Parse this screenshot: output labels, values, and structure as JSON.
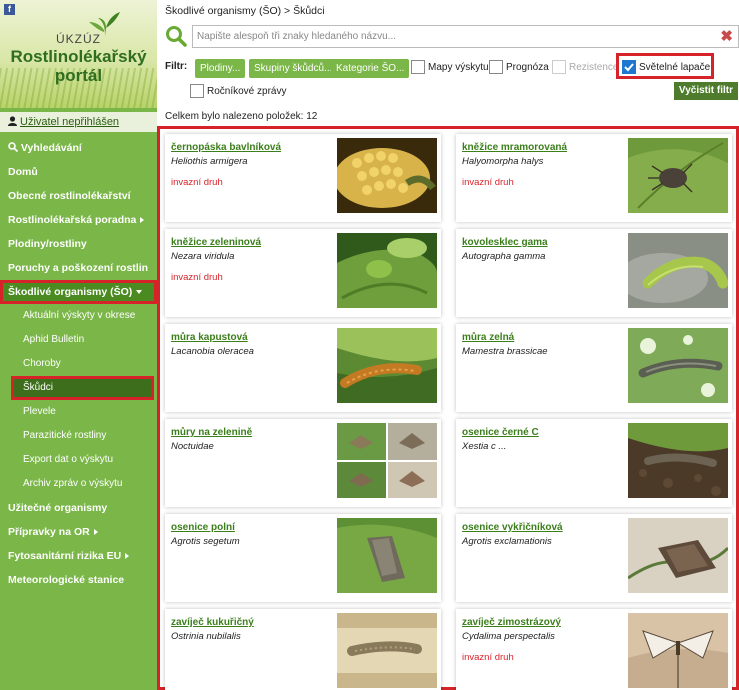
{
  "sidebar": {
    "facebook_icon": "f",
    "logo_small": "ÚKZÚZ",
    "logo_title_1": "Rostlinolékařský",
    "logo_title_2": "portál",
    "user_status": "Uživatel nepřihlášen",
    "nav": [
      {
        "label": "Vyhledávání"
      },
      {
        "label": "Domů"
      },
      {
        "label": "Obecné rostlinolékařství"
      },
      {
        "label": "Rostlinolékařská poradna"
      },
      {
        "label": "Plodiny/rostliny"
      },
      {
        "label": "Poruchy a poškození rostlin"
      },
      {
        "label": "Škodlivé organismy (ŠO)"
      },
      {
        "label": "Aktuální výskyty v okrese"
      },
      {
        "label": "Aphid Bulletin"
      },
      {
        "label": "Choroby"
      },
      {
        "label": "Škůdci"
      },
      {
        "label": "Plevele"
      },
      {
        "label": "Parazitické rostliny"
      },
      {
        "label": "Export dat o výskytu"
      },
      {
        "label": "Archiv zpráv o výskytu"
      },
      {
        "label": "Užitečné organismy"
      },
      {
        "label": "Přípravky na OR"
      },
      {
        "label": "Fytosanitární rizika EU"
      },
      {
        "label": "Meteorologické stanice"
      }
    ]
  },
  "breadcrumb": "Škodlivé organismy (ŠO) > Škůdci",
  "search": {
    "placeholder": "Napište alespoň tři znaky hledaného názvu..."
  },
  "filter": {
    "label": "Filtr:",
    "buttons": [
      "Plodiny...",
      "Skupiny škůdců...",
      "Kategorie ŠO..."
    ],
    "checkboxes": [
      {
        "label": "Mapy výskytu",
        "checked": false
      },
      {
        "label": "Prognóza",
        "checked": false
      },
      {
        "label": "Rezistence",
        "checked": false,
        "disabled": true
      },
      {
        "label": "Světelné lapače",
        "checked": true
      },
      {
        "label": "Ročníkové zprávy",
        "checked": false
      }
    ],
    "clear_label": "Vyčistit filtr"
  },
  "result_count": "Celkem bylo nalezeno položek: 12",
  "cards": [
    {
      "name": "černopáska bavlníková",
      "latin": "Heliothis armigera",
      "tag": "invazní druh"
    },
    {
      "name": "kněžice mramorovaná",
      "latin": "Halyomorpha halys",
      "tag": "invazní druh"
    },
    {
      "name": "kněžice zeleninová",
      "latin": "Nezara viridula",
      "tag": "invazní druh"
    },
    {
      "name": "kovolesklec gama",
      "latin": "Autographa gamma",
      "tag": ""
    },
    {
      "name": "můra kapustová",
      "latin": "Lacanobia oleracea",
      "tag": ""
    },
    {
      "name": "můra zelná",
      "latin": "Mamestra brassicae",
      "tag": ""
    },
    {
      "name": "můry na zelenině",
      "latin": "Noctuidae",
      "tag": ""
    },
    {
      "name": "osenice černé C",
      "latin": "Xestia c ...",
      "tag": ""
    },
    {
      "name": "osenice polní",
      "latin": "Agrotis segetum",
      "tag": ""
    },
    {
      "name": "osenice vykřičníková",
      "latin": "Agrotis exclamationis",
      "tag": ""
    },
    {
      "name": "zavíječ kukuřičný",
      "latin": "Ostrinia nubilalis",
      "tag": ""
    },
    {
      "name": "zavíječ zimostrázový",
      "latin": "Cydalima perspectalis",
      "tag": "invazní druh"
    }
  ]
}
